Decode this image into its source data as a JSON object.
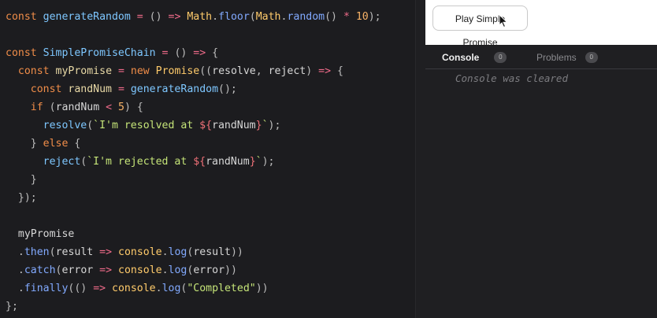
{
  "editor": {
    "lines": [
      "const generateRandom = () => Math.floor(Math.random() * 10);",
      "",
      "const SimplePromiseChain = () => {",
      "  const myPromise = new Promise((resolve, reject) => {",
      "    const randNum = generateRandom();",
      "    if (randNum < 5) {",
      "      resolve(`I'm resolved at ${randNum}`);",
      "    } else {",
      "      reject(`I'm rejected at ${randNum}`);",
      "    }",
      "  });",
      "",
      "  myPromise",
      "  .then(result => console.log(result))",
      "  .catch(error => console.log(error))",
      "  .finally(() => console.log(\"Completed\"))",
      "};"
    ]
  },
  "preview": {
    "play_button_label": "Play Simple Promise",
    "cursor_icon": "mouse-pointer-icon"
  },
  "console_panel": {
    "tabs": [
      {
        "label": "Console",
        "count": "0"
      },
      {
        "label": "Problems",
        "count": "0"
      }
    ],
    "message": "Console was cleared"
  },
  "colors": {
    "editor_bg": "#1c1c1f",
    "keyword": "#f08d49",
    "function": "#7ec7ff",
    "string": "#c5e478"
  }
}
